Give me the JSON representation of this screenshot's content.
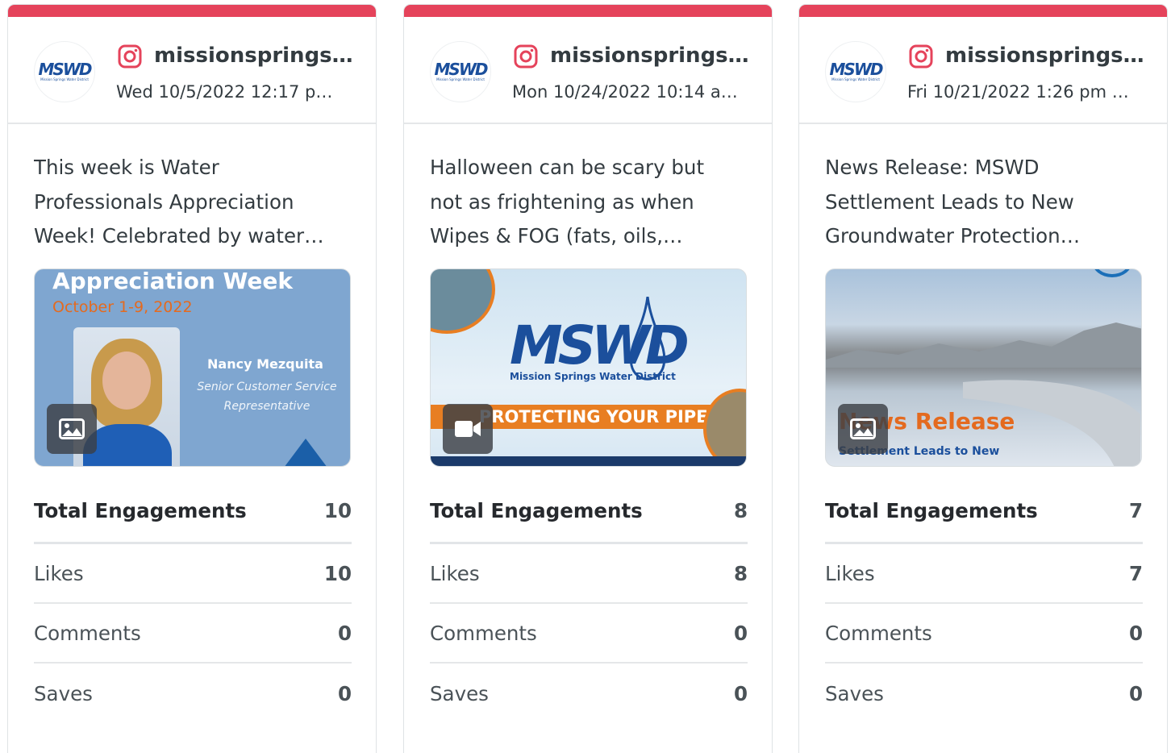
{
  "accent_color": "#e5435b",
  "cards": [
    {
      "avatar": {
        "logo": "MSWD",
        "sub": "Mission Springs Water District"
      },
      "platform_icon": "instagram-icon",
      "handle": "missionsprings…",
      "date": "Wed 10/5/2022 12:17 p…",
      "text": "This week is Water Professionals Appreciation Week! Celebrated by water…",
      "media": {
        "type_icon": "image-icon",
        "title": "Appreciation Week",
        "dates": "October 1-9, 2022",
        "name": "Nancy Mezquita",
        "role": "Senior Customer Service Representative"
      },
      "stats": [
        {
          "label": "Total Engagements",
          "value": "10"
        },
        {
          "label": "Likes",
          "value": "10"
        },
        {
          "label": "Comments",
          "value": "0"
        },
        {
          "label": "Saves",
          "value": "0"
        }
      ]
    },
    {
      "avatar": {
        "logo": "MSWD",
        "sub": "Mission Springs Water District"
      },
      "platform_icon": "instagram-icon",
      "handle": "missionsprings…",
      "date": "Mon 10/24/2022 10:14 a…",
      "text": "Halloween can be scary but not as frightening as when Wipes & FOG (fats, oils,…",
      "media": {
        "type_icon": "video-icon",
        "logo": "MSWD",
        "sub": "Mission Springs Water District",
        "ribbon": "PROTECTING YOUR PIPES"
      },
      "stats": [
        {
          "label": "Total Engagements",
          "value": "8"
        },
        {
          "label": "Likes",
          "value": "8"
        },
        {
          "label": "Comments",
          "value": "0"
        },
        {
          "label": "Saves",
          "value": "0"
        }
      ]
    },
    {
      "avatar": {
        "logo": "MSWD",
        "sub": "Mission Springs Water District"
      },
      "platform_icon": "instagram-icon",
      "handle": "missionsprings…",
      "date": "Fri 10/21/2022 1:26 pm …",
      "text": "News Release: MSWD Settlement Leads to New Groundwater Protection…",
      "media": {
        "type_icon": "image-icon",
        "headline": "News Release",
        "subline": "Settlement Leads to New"
      },
      "stats": [
        {
          "label": "Total Engagements",
          "value": "7"
        },
        {
          "label": "Likes",
          "value": "7"
        },
        {
          "label": "Comments",
          "value": "0"
        },
        {
          "label": "Saves",
          "value": "0"
        }
      ]
    }
  ]
}
